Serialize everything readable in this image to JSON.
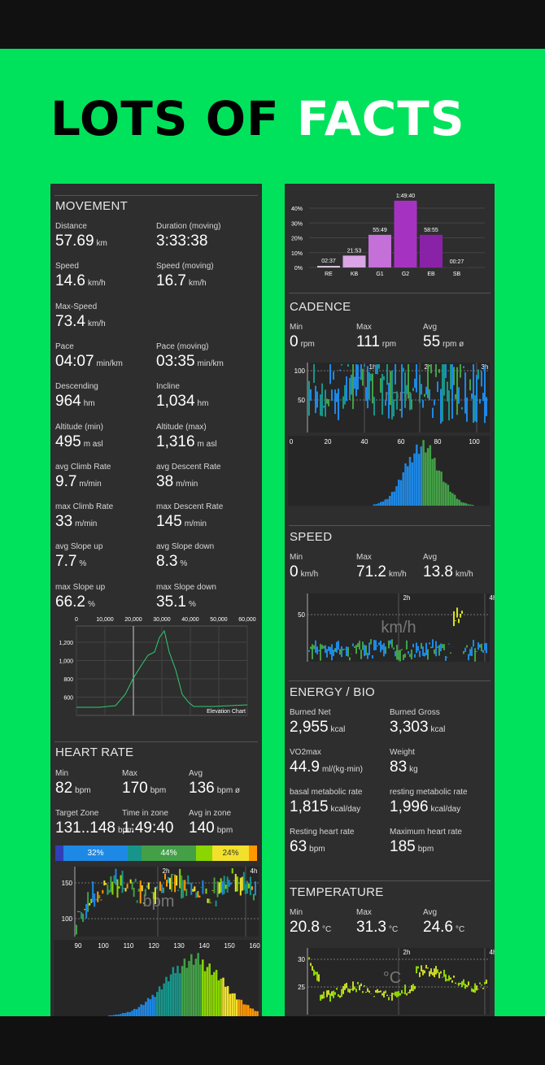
{
  "headline": {
    "part1": "LOTS OF ",
    "part2": "FACTS"
  },
  "movement": {
    "title": "MOVEMENT",
    "stats": [
      {
        "label": "Distance",
        "value": "57.69",
        "unit": "km"
      },
      {
        "label": "Duration (moving)",
        "value": "3:33:38",
        "unit": ""
      },
      {
        "label": "Speed",
        "value": "14.6",
        "unit": "km/h"
      },
      {
        "label": "Speed (moving)",
        "value": "16.7",
        "unit": "km/h"
      },
      {
        "label": "Max-Speed",
        "value": "73.4",
        "unit": "km/h"
      },
      {
        "label": "Pace",
        "value": "04:07",
        "unit": "min/km"
      },
      {
        "label": "Pace (moving)",
        "value": "03:35",
        "unit": "min/km"
      },
      {
        "label": "Descending",
        "value": "964",
        "unit": "hm"
      },
      {
        "label": "Incline",
        "value": "1,034",
        "unit": "hm"
      },
      {
        "label": "Altitude (min)",
        "value": "495",
        "unit": "m asl"
      },
      {
        "label": "Altitude (max)",
        "value": "1,316",
        "unit": "m asl"
      },
      {
        "label": "avg Climb Rate",
        "value": "9.7",
        "unit": "m/min"
      },
      {
        "label": "avg Descent Rate",
        "value": "38",
        "unit": "m/min"
      },
      {
        "label": "max Climb Rate",
        "value": "33",
        "unit": "m/min"
      },
      {
        "label": "max Descent Rate",
        "value": "145",
        "unit": "m/min"
      },
      {
        "label": "avg Slope up",
        "value": "7.7",
        "unit": "%"
      },
      {
        "label": "avg Slope down",
        "value": "8.3",
        "unit": "%"
      },
      {
        "label": "max Slope up",
        "value": "66.2",
        "unit": "%"
      },
      {
        "label": "max Slope down",
        "value": "35.1",
        "unit": "%"
      }
    ],
    "elevation_chart": {
      "caption": "Elevation Chart",
      "x_ticks": [
        "0",
        "10,000",
        "20,000",
        "30,000",
        "40,000",
        "50,000",
        "60,000"
      ],
      "y_ticks": [
        "1,200",
        "1,000",
        "800",
        "600"
      ]
    }
  },
  "heart_rate": {
    "title": "HEART RATE",
    "stats": [
      {
        "label": "Min",
        "value": "82",
        "unit": "bpm"
      },
      {
        "label": "Max",
        "value": "170",
        "unit": "bpm"
      },
      {
        "label": "Avg",
        "value": "136",
        "unit": "bpm ø"
      },
      {
        "label": "Target Zone",
        "value": "131..148",
        "unit": "bpm"
      },
      {
        "label": "Time in zone",
        "value": "1:49:40",
        "unit": ""
      },
      {
        "label": "Avg in zone",
        "value": "140",
        "unit": "bpm"
      }
    ],
    "zones": [
      {
        "label": "",
        "fraction": 0.04,
        "color": "#2f3fb8"
      },
      {
        "label": "32%",
        "fraction": 0.32,
        "color": "#1e88e5"
      },
      {
        "label": "",
        "fraction": 0.07,
        "color": "#17958a"
      },
      {
        "label": "44%",
        "fraction": 0.27,
        "color": "#43a047"
      },
      {
        "label": "",
        "fraction": 0.08,
        "color": "#8bd600"
      },
      {
        "label": "24%",
        "fraction": 0.18,
        "color": "#f2e12c"
      },
      {
        "label": "",
        "fraction": 0.04,
        "color": "#ff9800"
      }
    ],
    "time_ticks": [
      "2h",
      "4h"
    ],
    "y_ticks": [
      "150",
      "100"
    ],
    "watermark": "bpm",
    "hist_ticks": [
      "90",
      "100",
      "110",
      "120",
      "130",
      "140",
      "150",
      "160"
    ]
  },
  "zones_chart": {
    "categories": [
      "RE",
      "KB",
      "G1",
      "G2",
      "EB",
      "SB"
    ],
    "values": [
      1,
      8,
      22,
      45,
      22,
      0.5
    ],
    "labels": [
      "02:37",
      "21:53",
      "55:49",
      "1:49:40",
      "58:55",
      "00:27"
    ],
    "colors": [
      "#e8d6ee",
      "#d9a5e6",
      "#c56fd8",
      "#a632c2",
      "#8a22a8",
      "#3a2a40"
    ],
    "y_ticks": [
      "40%",
      "30%",
      "20%",
      "10%",
      "0%"
    ]
  },
  "cadence": {
    "title": "CADENCE",
    "stats": [
      {
        "label": "Min",
        "value": "0",
        "unit": "rpm"
      },
      {
        "label": "Max",
        "value": "111",
        "unit": "rpm"
      },
      {
        "label": "Avg",
        "value": "55",
        "unit": "rpm ø"
      }
    ],
    "time_ticks": [
      "1h",
      "2h",
      "3h"
    ],
    "y_ticks": [
      "100",
      "50"
    ],
    "watermark": "rpm",
    "hist_ticks": [
      "0",
      "20",
      "40",
      "60",
      "80",
      "100"
    ]
  },
  "speed": {
    "title": "SPEED",
    "stats": [
      {
        "label": "Min",
        "value": "0",
        "unit": "km/h"
      },
      {
        "label": "Max",
        "value": "71.2",
        "unit": "km/h"
      },
      {
        "label": "Avg",
        "value": "13.8",
        "unit": "km/h"
      }
    ],
    "time_ticks": [
      "2h",
      "4h"
    ],
    "y_ticks": [
      "50"
    ],
    "watermark": "km/h"
  },
  "energy": {
    "title": "ENERGY / BIO",
    "stats": [
      {
        "label": "Burned Net",
        "value": "2,955",
        "unit": "kcal"
      },
      {
        "label": "Burned Gross",
        "value": "3,303",
        "unit": "kcal"
      },
      {
        "label": "VO2max",
        "value": "44.9",
        "unit": "ml/(kg·min)"
      },
      {
        "label": "Weight",
        "value": "83",
        "unit": "kg"
      },
      {
        "label": "basal metabolic rate",
        "value": "1,815",
        "unit": "kcal/day"
      },
      {
        "label": "resting metabolic rate",
        "value": "1,996",
        "unit": "kcal/day"
      },
      {
        "label": "Resting heart rate",
        "value": "63",
        "unit": "bpm"
      },
      {
        "label": "Maximum heart rate",
        "value": "185",
        "unit": "bpm"
      }
    ]
  },
  "temperature": {
    "title": "TEMPERATURE",
    "stats": [
      {
        "label": "Min",
        "value": "20.8",
        "unit": "°C"
      },
      {
        "label": "Max",
        "value": "31.3",
        "unit": "°C"
      },
      {
        "label": "Avg",
        "value": "24.6",
        "unit": "°C"
      }
    ],
    "time_ticks": [
      "2h",
      "4h"
    ],
    "y_ticks": [
      "30",
      "25"
    ],
    "watermark": "°C"
  }
}
